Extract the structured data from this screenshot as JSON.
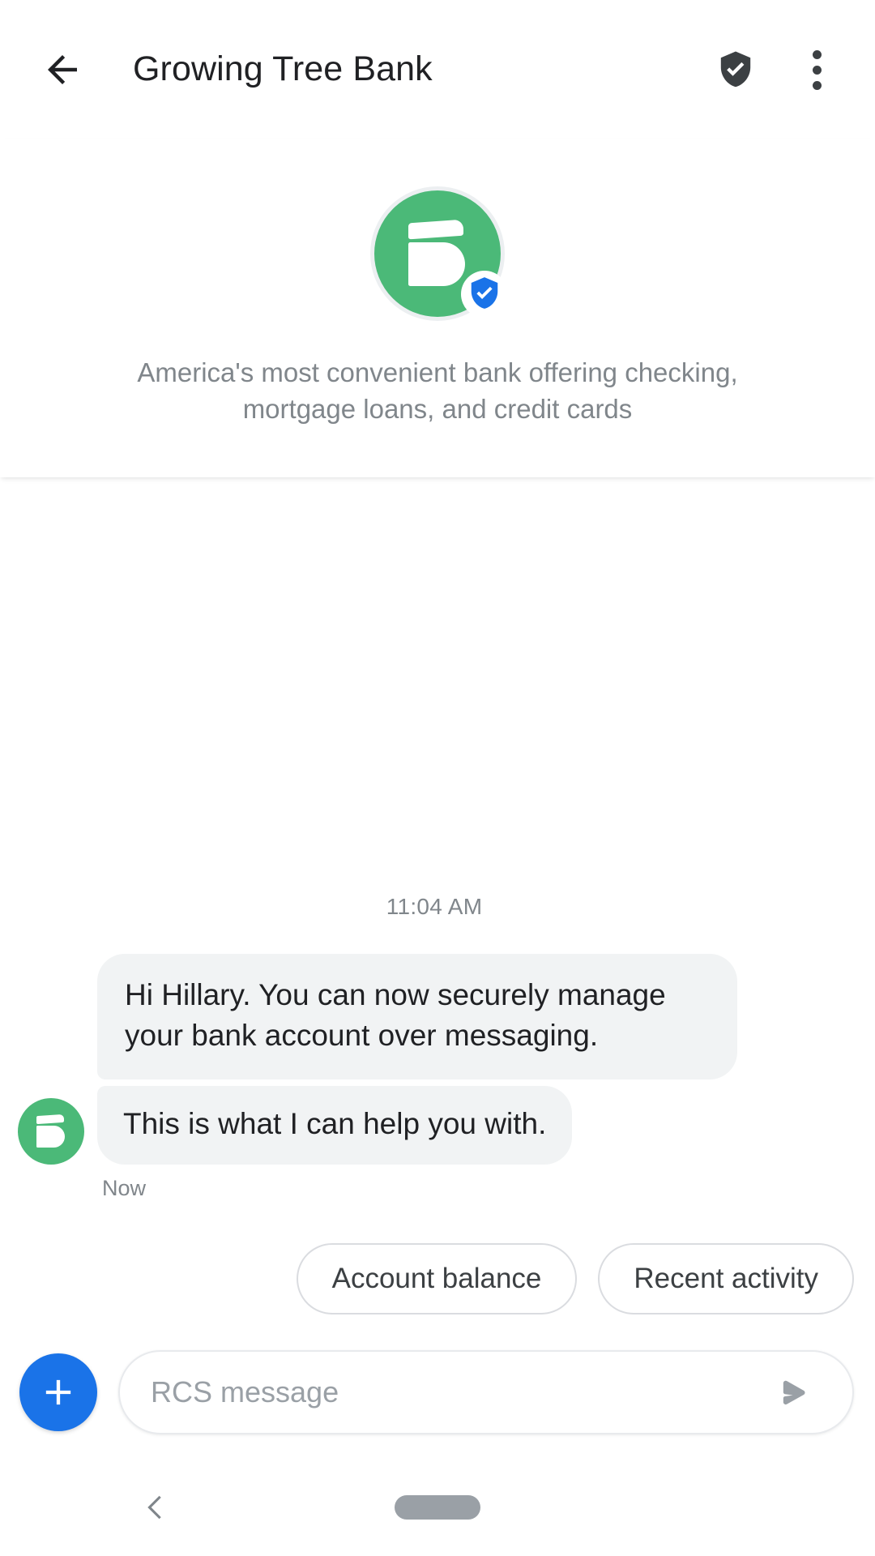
{
  "appbar": {
    "back_icon": "arrow-left-icon",
    "title": "Growing Tree Bank",
    "verified_icon": "shield-check-icon",
    "overflow_icon": "more-vert-icon"
  },
  "brand": {
    "avatar_icon": "leaf-logo-icon",
    "avatar_color": "#4bb978",
    "verified_badge_icon": "verified-shield-icon",
    "verified_badge_color": "#1a73e8",
    "description": "America's most convenient bank offering checking, mortgage loans, and credit cards"
  },
  "conversation": {
    "timestamp": "11:04 AM",
    "messages": [
      {
        "id": "msg-1",
        "sender": "brand",
        "text": "Hi Hillary. You can now securely manage your bank account over messaging."
      },
      {
        "id": "msg-2",
        "sender": "brand",
        "text": "This is what I can help you with."
      }
    ],
    "status": "Now",
    "bubble_color": "#f1f3f4",
    "text_color": "#202124"
  },
  "suggestions": {
    "chips": [
      {
        "label": "Account balance"
      },
      {
        "label": "Recent activity"
      }
    ]
  },
  "composer": {
    "plus_icon": "plus-icon",
    "plus_color": "#1a73e8",
    "placeholder": "RCS message",
    "value": "",
    "send_icon": "send-icon"
  },
  "navbar": {
    "back_icon": "chevron-left-icon",
    "home_pill": "home-pill-indicator"
  }
}
